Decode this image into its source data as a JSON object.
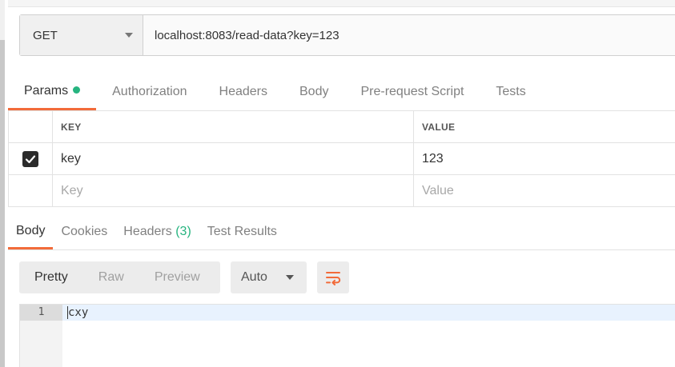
{
  "request": {
    "method": "GET",
    "url": "localhost:8083/read-data?key=123"
  },
  "request_tabs": [
    {
      "label": "Params",
      "active": true,
      "indicator": "green-dot"
    },
    {
      "label": "Authorization"
    },
    {
      "label": "Headers"
    },
    {
      "label": "Body"
    },
    {
      "label": "Pre-request Script"
    },
    {
      "label": "Tests"
    }
  ],
  "params": {
    "headers": {
      "key": "KEY",
      "value": "VALUE"
    },
    "rows": [
      {
        "checked": true,
        "key": "key",
        "value": "123"
      }
    ],
    "placeholder": {
      "key": "Key",
      "value": "Value"
    }
  },
  "response_tabs": [
    {
      "label": "Body",
      "active": true
    },
    {
      "label": "Cookies"
    },
    {
      "label": "Headers",
      "count": "(3)"
    },
    {
      "label": "Test Results"
    }
  ],
  "view_modes": [
    {
      "label": "Pretty",
      "active": true
    },
    {
      "label": "Raw"
    },
    {
      "label": "Preview"
    }
  ],
  "format": {
    "selected": "Auto"
  },
  "response_body": {
    "lines": [
      {
        "number": "1",
        "text": "cxy"
      }
    ]
  },
  "colors": {
    "accent": "#f26b3a",
    "indicator": "#26b47f",
    "line_highlight": "#e8f2fe"
  },
  "icons": {
    "method_dropdown": "chevron-down-icon",
    "checkbox": "checkmark-icon",
    "format_dropdown": "chevron-down-icon",
    "wrap": "wrap-lines-icon"
  }
}
